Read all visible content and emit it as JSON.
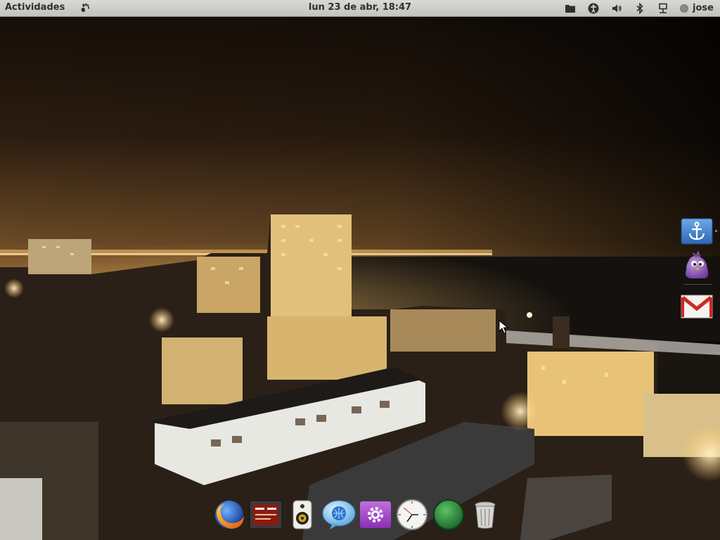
{
  "topbar": {
    "activities_label": "Actividades",
    "clock_text": "lun 23 de abr, 18:47",
    "user_name": "jose",
    "tray_icons": [
      "folder-icon",
      "accessibility-icon",
      "volume-icon",
      "bluetooth-icon",
      "network-icon"
    ]
  },
  "sidebar": {
    "items": [
      "anchor-app-icon",
      "pidgin-icon",
      "gmail-icon"
    ]
  },
  "dock": {
    "items": [
      "firefox-icon",
      "presentation-icon",
      "speaker-icon",
      "chat-icon",
      "settings-icon",
      "clock-icon",
      "green-ball-icon",
      "trash-icon"
    ]
  },
  "colors": {
    "topbar_bg": "#cfcfcc",
    "topbar_text": "#2f2f2f",
    "sky_glow": "#c99545",
    "city_light": "#ffcf7a"
  }
}
